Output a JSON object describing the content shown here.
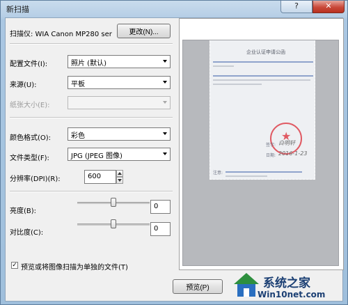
{
  "window": {
    "title": "新扫描",
    "help_label": "?",
    "close_label": "✕"
  },
  "scanner": {
    "label": "扫描仪: WIA Canon MP280 ser",
    "change_button": "更改(N)..."
  },
  "profile": {
    "label": "配置文件(I):",
    "value": "照片 (默认)"
  },
  "source": {
    "label": "来源(U):",
    "value": "平板"
  },
  "paper_size": {
    "label": "纸张大小(E):",
    "value": ""
  },
  "color_format": {
    "label": "颜色格式(O):",
    "value": "彩色"
  },
  "file_type": {
    "label": "文件类型(F):",
    "value": "JPG (JPEG 图像)"
  },
  "resolution": {
    "label": "分辨率(DPI)(R):",
    "value": "600"
  },
  "brightness": {
    "label": "亮度(B):",
    "value": "0"
  },
  "contrast": {
    "label": "对比度(C):",
    "value": "0"
  },
  "separate_files": {
    "label": "预览或将图像扫描为单独的文件(T)",
    "checked": true,
    "check_glyph": "✓"
  },
  "preview_button": "预览(P)",
  "document": {
    "title": "企业认证申请公函",
    "sign_label": "签字:",
    "date_label": "日期:",
    "signature": "白明轩",
    "date": "2016-1-23",
    "note_label": "注意:"
  },
  "watermark": {
    "brand": "系统之家",
    "site": "Win10net.com"
  },
  "colors": {
    "title_bar": "#b7cfe6",
    "close_button": "#c9493a",
    "stamp": "#e05a63",
    "brand": "#1b3f73"
  }
}
